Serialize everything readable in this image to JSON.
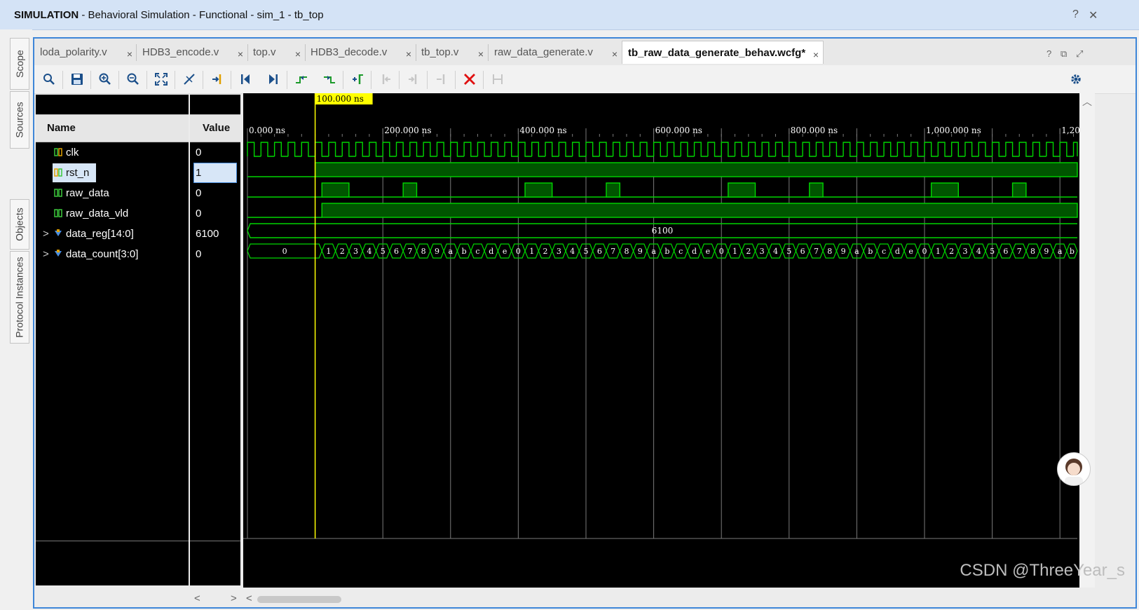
{
  "window": {
    "mode": "SIMULATION",
    "title_rest": " - Behavioral Simulation - Functional - sim_1 - tb_top",
    "help_icon": "question-icon",
    "close_icon": "close-icon"
  },
  "side_tabs": [
    "Scope",
    "Sources",
    "Objects",
    "Protocol Instances"
  ],
  "editor_tabs": [
    {
      "label": "loda_polarity.v",
      "active": false
    },
    {
      "label": "HDB3_encode.v",
      "active": false
    },
    {
      "label": "top.v",
      "active": false
    },
    {
      "label": "HDB3_decode.v",
      "active": false
    },
    {
      "label": "tb_top.v",
      "active": false
    },
    {
      "label": "raw_data_generate.v",
      "active": false
    },
    {
      "label": "tb_raw_data_generate_behav.wcfg*",
      "active": true
    }
  ],
  "tab_close_glyph": "×",
  "toolbar": {
    "buttons": [
      "search-icon",
      "save-icon",
      "zoom-in-icon",
      "zoom-out-icon",
      "zoom-fit-icon",
      "snap-icon",
      "goto-cursor-icon",
      "goto-start-icon",
      "goto-end-icon",
      "prev-transition-icon",
      "next-transition-icon",
      "add-marker-icon",
      "prev-marker-icon",
      "next-marker-icon",
      "delete-marker-icon",
      "remove-markers-icon",
      "settings-icon"
    ]
  },
  "columns": {
    "name": "Name",
    "value": "Value"
  },
  "signals": [
    {
      "name": "clk",
      "value": "0",
      "kind": "bit",
      "expandable": false
    },
    {
      "name": "rst_n",
      "value": "1",
      "kind": "bit",
      "expandable": false,
      "selected": true
    },
    {
      "name": "raw_data",
      "value": "0",
      "kind": "bit",
      "expandable": false
    },
    {
      "name": "raw_data_vld",
      "value": "0",
      "kind": "bit",
      "expandable": false
    },
    {
      "name": "data_reg[14:0]",
      "value": "6100",
      "kind": "bus",
      "expandable": true
    },
    {
      "name": "data_count[3:0]",
      "value": "0",
      "kind": "bus",
      "expandable": true
    }
  ],
  "expand_glyph": ">",
  "waveform": {
    "cursor_label": "100.000 ns",
    "cursor_time": 100,
    "time_start": 0,
    "time_end": 1230,
    "ticks": [
      "0.000 ns",
      "200.000 ns",
      "400.000 ns",
      "600.000 ns",
      "800.000 ns",
      "1,000.000 ns",
      "1,200.000 ns"
    ],
    "tick_times": [
      0,
      200,
      400,
      600,
      800,
      1000,
      1200
    ],
    "clk_period": 20,
    "rst_n_high_from": 100,
    "raw_data_vld_high_from": 110,
    "raw_data_pulses": [
      [
        110,
        150
      ],
      [
        230,
        250
      ],
      [
        410,
        450
      ],
      [
        530,
        550
      ],
      [
        710,
        750
      ],
      [
        830,
        850
      ],
      [
        1010,
        1050
      ],
      [
        1130,
        1150
      ]
    ],
    "data_reg_value": "6100",
    "data_count_initial": "0",
    "data_count_sequence": [
      "1",
      "2",
      "3",
      "4",
      "5",
      "6",
      "7",
      "8",
      "9",
      "a",
      "b",
      "c",
      "d",
      "e",
      "0"
    ],
    "data_count_start": 110,
    "data_count_step": 20,
    "colors": {
      "wave": "#00d600",
      "fill": "#005500",
      "cursor": "#ffff00",
      "grid": "#7a7a7a",
      "text": "#ffffff"
    }
  },
  "scroll": {
    "left": "<",
    "right": ">"
  },
  "watermark": "CSDN @ThreeYear_s"
}
